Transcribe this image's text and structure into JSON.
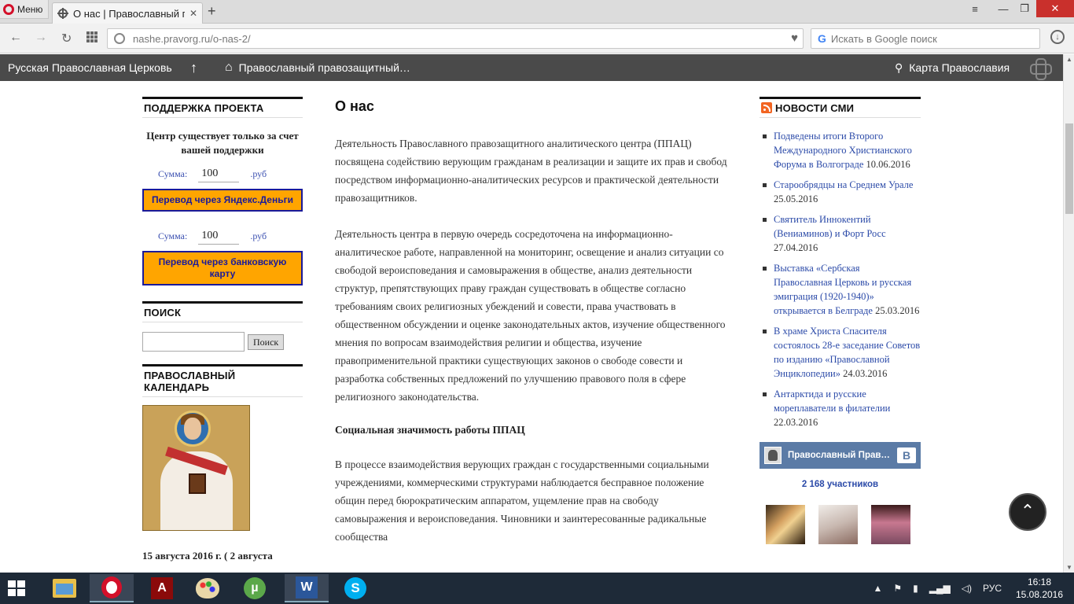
{
  "browser": {
    "menu_label": "Меню",
    "tab_title": "О нас | Православный пр…",
    "tab_close": "✕",
    "new_tab": "+",
    "url": "nashe.pravorg.ru/o-nas-2/",
    "search_placeholder": "Искать в Google поиск"
  },
  "sitebar": {
    "home_link": "Русская Православная Церковь",
    "up_arrow": "↑",
    "center_link": "Православный правозащитный…",
    "map_link": "Карта Православия"
  },
  "left": {
    "support_title": "ПОДДЕРЖКА ПРОЕКТА",
    "support_text": "Центр существует только за счет вашей поддержки",
    "amount_label": "Сумма:",
    "amount_value": "100",
    "currency": ".руб",
    "yandex_button": "Перевод через Яндекс.Деньги",
    "card_button": "Перевод через банковскую карту",
    "search_title": "ПОИСК",
    "search_button": "Поиск",
    "calendar_title": "ПРАВОСЛАВНЫЙ КАЛЕНДАРЬ",
    "calendar_date": "15 августа 2016 г. ( 2 августа"
  },
  "main": {
    "title": "О нас",
    "p1": "Деятельность Православного правозащитного аналитического центра (ППАЦ) посвящена содействию верующим гражданам в реализации и защите их прав и свобод посредством информационно-аналитических ресурсов и практической деятельности правозащитников.",
    "p2": "Деятельность центра в первую очередь сосредоточена на информационно-аналитическое работе, направленной на мониторинг, освещение и анализ ситуации со свободой вероисповедания и самовыражения в обществе, анализ  деятельности структур, препятствующих праву граждан существовать в обществе согласно требованиям своих религиозных убеждений и совести, права участвовать в общественном обсуждении и оценке законодательных актов, изучение общественного мнения по вопросам взаимодействия религии и общества, изучение правоприменительной практики существующих законов о свободе совести и разработка собственных предложений по улучшению правового поля в сфере религиозного законодательства.",
    "heading": "Социальная значимость работы ППАЦ",
    "p3": "В процессе взаимодействия верующих граждан с государственными социальными учреждениями, коммерческими структурами наблюдается бесправное положение общин перед бюрократическим аппаратом, ущемление прав на свободу самовыражения и вероисповедания. Чиновники и заинтересованные радикальные сообщества"
  },
  "right": {
    "news_title": "НОВОСТИ СМИ",
    "news": [
      {
        "title": "Подведены итоги Второго Международного Христианского Форума в Волгограде",
        "date": "10.06.2016"
      },
      {
        "title": "Старообрядцы на Среднем Урале",
        "date": "25.05.2016"
      },
      {
        "title": "Святитель Иннокентий (Вениаминов) и Форт Росс",
        "date": "27.04.2016"
      },
      {
        "title": "Выставка «Сербская Православная Церковь и русская эмиграция (1920-1940)» открывается в Белграде",
        "date": "25.03.2016"
      },
      {
        "title": "В храме Христа Спасителя состоялось 28-е заседание Советов по изданию «Православной Энциклопедии»",
        "date": "24.03.2016"
      },
      {
        "title": "Антарктида и русские мореплаватели в филателии",
        "date": "22.03.2016"
      }
    ],
    "vk_name": "Православный Прав…",
    "vk_logo": "B",
    "members": "2 168 участников"
  },
  "taskbar": {
    "lang": "РУС",
    "time": "16:18",
    "date": "15.08.2016",
    "word_letter": "W",
    "skype_letter": "S",
    "acrobat_letter": "A",
    "utorrent_letter": "µ"
  }
}
